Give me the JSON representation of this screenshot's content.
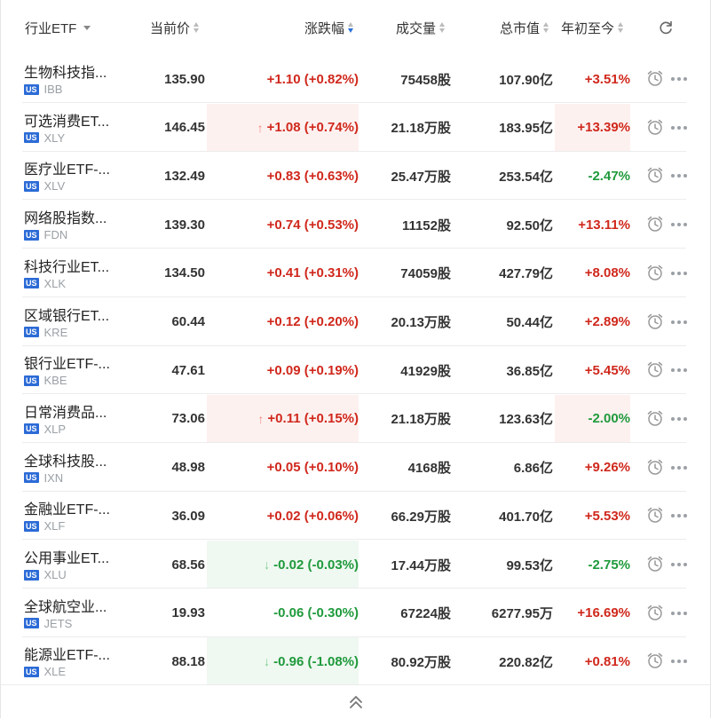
{
  "header": {
    "industry_label": "行业ETF",
    "price_label": "当前价",
    "change_label": "涨跌幅",
    "volume_label": "成交量",
    "market_cap_label": "总市值",
    "ytd_label": "年初至今"
  },
  "market_badge": "US",
  "rows": [
    {
      "name": "生物科技指...",
      "ticker": "IBB",
      "price": "135.90",
      "change": "+1.10 (+0.82%)",
      "volume": "75458股",
      "market_cap": "107.90亿",
      "ytd": "+3.51%",
      "change_dir": "up",
      "ytd_dir": "up",
      "flash": "none"
    },
    {
      "name": "可选消费ET...",
      "ticker": "XLY",
      "price": "146.45",
      "change": "+1.08 (+0.74%)",
      "volume": "21.18万股",
      "market_cap": "183.95亿",
      "ytd": "+13.39%",
      "change_dir": "up",
      "ytd_dir": "up",
      "flash": "up"
    },
    {
      "name": "医疗业ETF-...",
      "ticker": "XLV",
      "price": "132.49",
      "change": "+0.83 (+0.63%)",
      "volume": "25.47万股",
      "market_cap": "253.54亿",
      "ytd": "-2.47%",
      "change_dir": "up",
      "ytd_dir": "down",
      "flash": "none"
    },
    {
      "name": "网络股指数...",
      "ticker": "FDN",
      "price": "139.30",
      "change": "+0.74 (+0.53%)",
      "volume": "11152股",
      "market_cap": "92.50亿",
      "ytd": "+13.11%",
      "change_dir": "up",
      "ytd_dir": "up",
      "flash": "none"
    },
    {
      "name": "科技行业ET...",
      "ticker": "XLK",
      "price": "134.50",
      "change": "+0.41 (+0.31%)",
      "volume": "74059股",
      "market_cap": "427.79亿",
      "ytd": "+8.08%",
      "change_dir": "up",
      "ytd_dir": "up",
      "flash": "none"
    },
    {
      "name": "区域银行ET...",
      "ticker": "KRE",
      "price": "60.44",
      "change": "+0.12 (+0.20%)",
      "volume": "20.13万股",
      "market_cap": "50.44亿",
      "ytd": "+2.89%",
      "change_dir": "up",
      "ytd_dir": "up",
      "flash": "none"
    },
    {
      "name": "银行业ETF-...",
      "ticker": "KBE",
      "price": "47.61",
      "change": "+0.09 (+0.19%)",
      "volume": "41929股",
      "market_cap": "36.85亿",
      "ytd": "+5.45%",
      "change_dir": "up",
      "ytd_dir": "up",
      "flash": "none"
    },
    {
      "name": "日常消费品...",
      "ticker": "XLP",
      "price": "73.06",
      "change": "+0.11 (+0.15%)",
      "volume": "21.18万股",
      "market_cap": "123.63亿",
      "ytd": "-2.00%",
      "change_dir": "up",
      "ytd_dir": "down",
      "flash": "up"
    },
    {
      "name": "全球科技股...",
      "ticker": "IXN",
      "price": "48.98",
      "change": "+0.05 (+0.10%)",
      "volume": "4168股",
      "market_cap": "6.86亿",
      "ytd": "+9.26%",
      "change_dir": "up",
      "ytd_dir": "up",
      "flash": "none"
    },
    {
      "name": "金融业ETF-...",
      "ticker": "XLF",
      "price": "36.09",
      "change": "+0.02 (+0.06%)",
      "volume": "66.29万股",
      "market_cap": "401.70亿",
      "ytd": "+5.53%",
      "change_dir": "up",
      "ytd_dir": "up",
      "flash": "none"
    },
    {
      "name": "公用事业ET...",
      "ticker": "XLU",
      "price": "68.56",
      "change": "-0.02 (-0.03%)",
      "volume": "17.44万股",
      "market_cap": "99.53亿",
      "ytd": "-2.75%",
      "change_dir": "down",
      "ytd_dir": "down",
      "flash": "down"
    },
    {
      "name": "全球航空业...",
      "ticker": "JETS",
      "price": "19.93",
      "change": "-0.06 (-0.30%)",
      "volume": "67224股",
      "market_cap": "6277.95万",
      "ytd": "+16.69%",
      "change_dir": "down",
      "ytd_dir": "up",
      "flash": "none"
    },
    {
      "name": "能源业ETF-...",
      "ticker": "XLE",
      "price": "88.18",
      "change": "-0.96 (-1.08%)",
      "volume": "80.92万股",
      "market_cap": "220.82亿",
      "ytd": "+0.81%",
      "change_dir": "down",
      "ytd_dir": "up",
      "flash": "down"
    }
  ],
  "colors": {
    "up": "#d0281c",
    "down": "#1f9a3c",
    "badge": "#2c6bd6"
  },
  "icons": {
    "sort": "sort-icon",
    "refresh": "refresh-icon",
    "alarm": "alarm-clock-icon",
    "more": "more-dots-icon",
    "collapse": "double-chevron-up-icon"
  }
}
